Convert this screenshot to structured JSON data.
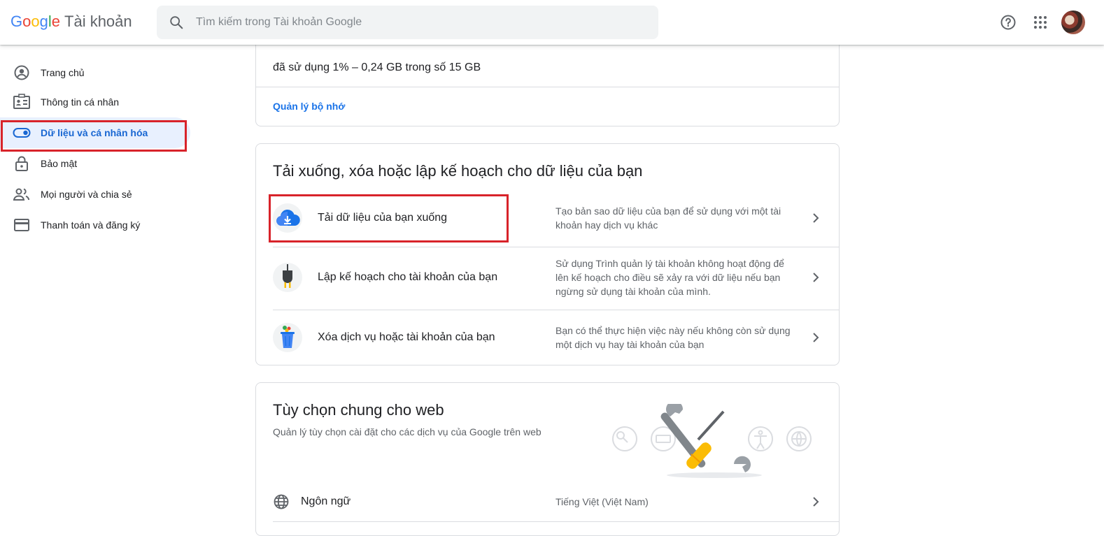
{
  "header": {
    "logo_letters": [
      "G",
      "o",
      "o",
      "g",
      "l",
      "e"
    ],
    "logo_colors": [
      "#4285f4",
      "#ea4335",
      "#fbbc05",
      "#4285f4",
      "#34a853",
      "#ea4335"
    ],
    "product": "Tài khoản",
    "search_placeholder": "Tìm kiếm trong Tài khoản Google",
    "icons": [
      "search-icon",
      "help-icon",
      "apps-icon",
      "avatar"
    ]
  },
  "sidebar": {
    "items": [
      {
        "label": "Trang chủ",
        "icon": "account-circle-icon"
      },
      {
        "label": "Thông tin cá nhân",
        "icon": "id-card-icon"
      },
      {
        "label": "Dữ liệu và cá nhân hóa",
        "icon": "toggle-icon",
        "active": true
      },
      {
        "label": "Bảo mật",
        "icon": "lock-icon"
      },
      {
        "label": "Mọi người và chia sẻ",
        "icon": "people-icon"
      },
      {
        "label": "Thanh toán và đăng ký",
        "icon": "credit-card-icon"
      }
    ]
  },
  "storage": {
    "usage": "đã sử dụng 1% – 0,24 GB trong số 15 GB",
    "manage_link": "Quản lý bộ nhớ"
  },
  "data_card": {
    "title": "Tải xuống, xóa hoặc lập kế hoạch cho dữ liệu của bạn",
    "rows": [
      {
        "label": "Tải dữ liệu của bạn xuống",
        "desc": "Tạo bản sao dữ liệu của bạn để sử dụng với một tài khoản hay dịch vụ khác",
        "icon": "cloud-download-icon"
      },
      {
        "label": "Lập kế hoạch cho tài khoản của bạn",
        "desc": "Sử dụng Trình quản lý tài khoản không hoạt động để lên kế hoạch cho điều sẽ xảy ra với dữ liệu nếu bạn ngừng sử dụng tài khoản của mình.",
        "icon": "plug-icon"
      },
      {
        "label": "Xóa dịch vụ hoặc tài khoản của bạn",
        "desc": "Bạn có thể thực hiện việc này nếu không còn sử dụng một dịch vụ hay tài khoản của bạn",
        "icon": "trash-icon"
      }
    ]
  },
  "web_card": {
    "title": "Tùy chọn chung cho web",
    "subtitle": "Quản lý tùy chọn cài đặt cho các dịch vụ của Google trên web",
    "language_label": "Ngôn ngữ",
    "language_value": "Tiếng Việt (Việt Nam)"
  },
  "colors": {
    "accent": "#1a73e8",
    "active_bg": "#e8f0fe",
    "highlight": "#d8232a"
  }
}
